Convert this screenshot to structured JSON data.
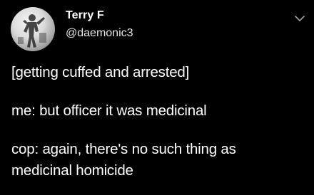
{
  "author": {
    "display_name": "Terry F",
    "handle": "@daemonic3",
    "avatar_icon": "avatar-figure-icon"
  },
  "menu": {
    "icon": "chevron-down-icon"
  },
  "tweet": {
    "lines": [
      "[getting cuffed and arrested]",
      "me: but officer it was medicinal",
      "cop: again, there's no such thing as",
      "medicinal homicide"
    ]
  },
  "colors": {
    "background": "#000000",
    "text": "#ffffff"
  }
}
